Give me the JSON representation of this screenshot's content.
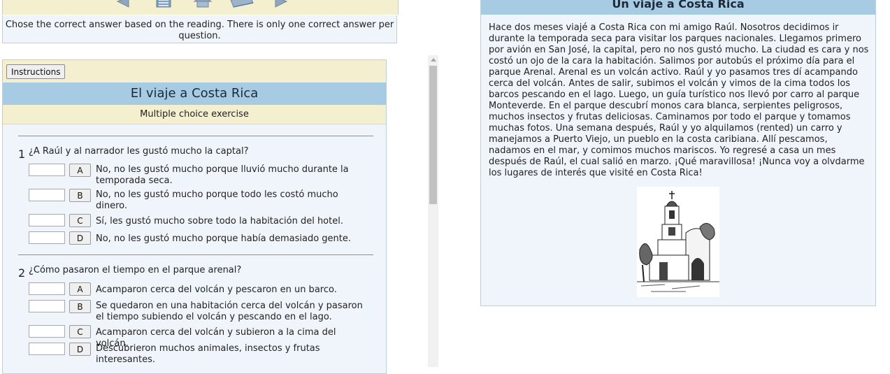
{
  "nav": {
    "icons": [
      "back-arrow-icon",
      "contents-icon",
      "home-icon",
      "book-icon",
      "forward-arrow-icon"
    ],
    "instructions": "Chose the correct answer based on the reading. There is only one correct answer per question."
  },
  "exercise": {
    "instructions_button": "Instructions",
    "title": "El viaje a Costa Rica",
    "subtitle": "Multiple choice exercise",
    "questions": [
      {
        "number": "1",
        "text": "¿A Raúl y al narrador les gustó mucho la captal?",
        "options": [
          {
            "letter": "A",
            "text": "No, no les gustó mucho porque lluvió mucho durante la temporada seca."
          },
          {
            "letter": "B",
            "text": "No, no les gustó mucho porque todo les costó mucho dinero."
          },
          {
            "letter": "C",
            "text": "Sí, les gustó mucho sobre todo la habitación del hotel."
          },
          {
            "letter": "D",
            "text": "No, no les gustó mucho porque había demasiado gente."
          }
        ]
      },
      {
        "number": "2",
        "text": "¿Cómo pasaron el tiempo en el parque arenal?",
        "options": [
          {
            "letter": "A",
            "text": "Acamparon cerca del volcán y pescaron en un barco."
          },
          {
            "letter": "B",
            "text": "Se quedaron en una habitación cerca del volcán y pasaron el tiempo subiendo el volcán y pescando en el lago."
          },
          {
            "letter": "C",
            "text": "Acamparon cerca del volcán y subieron a la cima del volcán."
          },
          {
            "letter": "D",
            "text": "Descubrieron muchos animales, insectos y frutas interesantes."
          }
        ]
      }
    ]
  },
  "reading": {
    "title": "Un viaje a Costa Rica",
    "body": "Hace dos meses viajé a Costa Rica con mi amigo Raúl. Nosotros decidimos ir durante la temporada seca para visitar los parques nacionales. Llegamos primero por avión en San José, la capital, pero no nos gustó mucho. La ciudad es cara y nos costó un ojo de la cara la habitación. Salimos por autobús el próximo día para el parque Arenal. Arenal es un volcán activo. Raúl y yo pasamos tres dí acampando cerca del volcán. Antes de salir, subimos el volcán y vimos de la cima todos los barcos pescando en el lago. Luego, un guía turístico nos llevó por carro al parque Monteverde. En el parque descubrí monos cara blanca, serpientes peligrosos, muchos insectos y frutas deliciosas. Caminamos por todo el parque y tomamos muchas fotos. Una semana después, Raúl y yo alquilamos (rented) un carro y manejamos a Puerto Viejo, un pueblo en la costa caribiana. Allí pescamos, nadamos en el mar, y comimos muchos mariscos. Yo regresé a casa un mes después de Raúl, el cual salió en marzo. ¡Qué maravillosa! ¡Nunca voy a olvdarme los lugares de interés que visité en Costa Rica!"
  }
}
